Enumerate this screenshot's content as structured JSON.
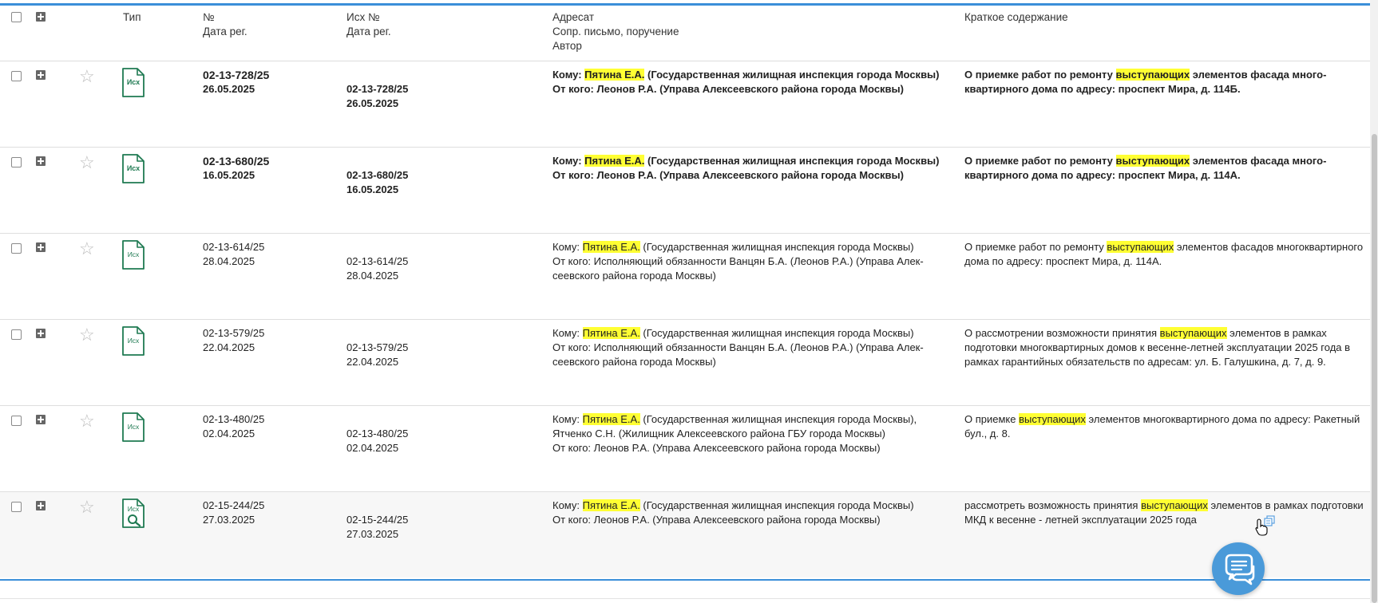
{
  "header": {
    "type": "Тип",
    "num": "№",
    "num_date": "Дата рег.",
    "out_num": "Исх №",
    "out_date": "Дата рег.",
    "addressee": "Адресат",
    "addressee_sub": "Сопр. письмо, поручение",
    "author": "Автор",
    "summary": "Краткое содержание"
  },
  "highlight": "выступающих",
  "rows": [
    {
      "icon_label": "Исх",
      "num": "02-13-728/25",
      "date": "26.05.2025",
      "out_num": "02-13-728/25",
      "out_date": "26.05.2025",
      "to_prefix": "Кому: ",
      "to_name": "Пятина Е.А.",
      "to_rest": " (Государственная жилищная инспекция города Москвы)",
      "from": "От кого: Леонов Р.А. (Управа Алексеевского района города Москвы)",
      "sum_before": "О приемке работ по ремонту ",
      "sum_hl": "выступающих",
      "sum_after": " элементов фасада много­квартирного дома по адресу: проспект Мира, д. 114Б."
    },
    {
      "icon_label": "Исх",
      "num": "02-13-680/25",
      "date": "16.05.2025",
      "out_num": "02-13-680/25",
      "out_date": "16.05.2025",
      "to_prefix": "Кому: ",
      "to_name": "Пятина Е.А.",
      "to_rest": " (Государственная жилищная инспекция города Москвы)",
      "from": "От кого: Леонов Р.А. (Управа Алексеевского района города Москвы)",
      "sum_before": "О приемке работ по ремонту ",
      "sum_hl": "выступающих",
      "sum_after": " элементов фасада много­квартирного дома по адресу: проспект Мира, д. 114А."
    },
    {
      "icon_label": "Исх",
      "num": "02-13-614/25",
      "date": "28.04.2025",
      "out_num": "02-13-614/25",
      "out_date": "28.04.2025",
      "to_prefix": "Кому: ",
      "to_name": "Пятина Е.А.",
      "to_rest": " (Государственная жилищная инспекция города Москвы)",
      "from": "От кого: Исполняющий обязанности Ванцян Б.А. (Леонов Р.А.) (Управа Алек­сеевского района города Москвы)",
      "sum_before": "О приемке работ по ремонту ",
      "sum_hl": "выступающих",
      "sum_after": " элементов фасадов многоквар­тирного дома по адресу: проспект Мира, д. 114А."
    },
    {
      "icon_label": "Исх",
      "num": "02-13-579/25",
      "date": "22.04.2025",
      "out_num": "02-13-579/25",
      "out_date": "22.04.2025",
      "to_prefix": "Кому: ",
      "to_name": "Пятина Е.А.",
      "to_rest": " (Государственная жилищная инспекция города Москвы)",
      "from": "От кого: Исполняющий обязанности Ванцян Б.А. (Леонов Р.А.) (Управа Алек­сеевского района города Москвы)",
      "sum_before": "О рассмотрении возможности принятия ",
      "sum_hl": "выступающих",
      "sum_after": " элементов в рамках подготовки многоквартирных домов к весенне-летней эксплуатации 2025 года в рамках гарантийных обязательств по адресам: ул. Б. Галушкина, д. 7, д. 9."
    },
    {
      "icon_label": "Исх",
      "num": "02-13-480/25",
      "date": "02.04.2025",
      "out_num": "02-13-480/25",
      "out_date": "02.04.2025",
      "to_prefix": "Кому: ",
      "to_name": "Пятина Е.А.",
      "to_rest": " (Государственная жилищная инспекция города Москвы), Ятченко С.Н. (Жилищник Алексеевского района ГБУ города Москвы)",
      "from": "От кого: Леонов Р.А. (Управа Алексеевского района города Москвы)",
      "sum_before": "О приемке ",
      "sum_hl": "выступающих",
      "sum_after": " элементов многоквартирного дома по адресу: Ра­кетный бул., д. 8."
    },
    {
      "icon_label": "Исх",
      "num": "02-15-244/25",
      "date": "27.03.2025",
      "out_num": "02-15-244/25",
      "out_date": "27.03.2025",
      "to_prefix": "Кому: ",
      "to_name": "Пятина Е.А.",
      "to_rest": " (Государственная жилищная инспекция города Москвы)",
      "from": "От кого: Леонов Р.А. (Управа Алексеевского района города Москвы)",
      "sum_before": "рассмотреть возможность принятия ",
      "sum_hl": "выступающих",
      "sum_after": " элементов в рамках под­готовки МКД к весенне - летней эксплуатации 2025 года"
    }
  ],
  "colors": {
    "accent": "#3b8fd9",
    "highlight": "#ffff33",
    "doc_icon": "#1f7a52",
    "chat_button": "#4a9ad9"
  }
}
